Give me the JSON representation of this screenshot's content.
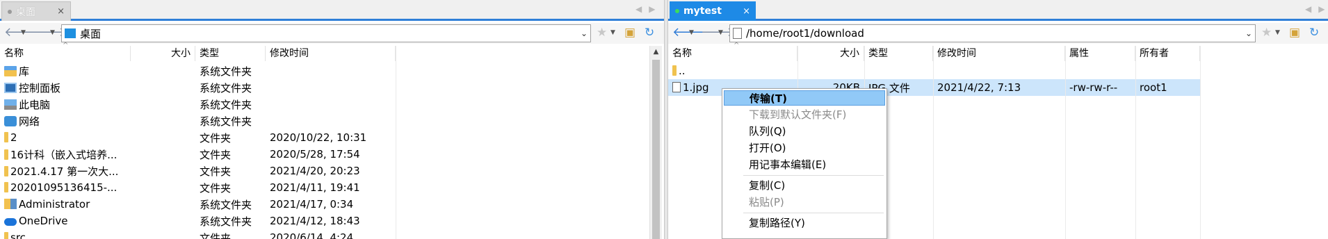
{
  "left": {
    "tab_label": "桌面",
    "tab_close": "×",
    "address": "桌面",
    "columns": [
      "名称",
      "大小",
      "类型",
      "修改时间"
    ],
    "rows": [
      {
        "name": "库",
        "size": "",
        "type": "系统文件夹",
        "modified": "",
        "icon": "library-icon"
      },
      {
        "name": "控制面板",
        "size": "",
        "type": "系统文件夹",
        "modified": "",
        "icon": "control-panel-icon"
      },
      {
        "name": "此电脑",
        "size": "",
        "type": "系统文件夹",
        "modified": "",
        "icon": "computer-icon"
      },
      {
        "name": "网络",
        "size": "",
        "type": "系统文件夹",
        "modified": "",
        "icon": "network-icon"
      },
      {
        "name": "2",
        "size": "",
        "type": "文件夹",
        "modified": "2020/10/22, 10:31",
        "icon": "folder-icon"
      },
      {
        "name": "16计科（嵌入式培养...",
        "size": "",
        "type": "文件夹",
        "modified": "2020/5/28, 17:54",
        "icon": "folder-icon"
      },
      {
        "name": "2021.4.17 第一次大...",
        "size": "",
        "type": "文件夹",
        "modified": "2021/4/20, 20:23",
        "icon": "folder-icon"
      },
      {
        "name": "20201095136415-...",
        "size": "",
        "type": "文件夹",
        "modified": "2021/4/11, 19:41",
        "icon": "folder-icon"
      },
      {
        "name": "Administrator",
        "size": "",
        "type": "系统文件夹",
        "modified": "2021/4/17, 0:34",
        "icon": "user-folder-icon"
      },
      {
        "name": "OneDrive",
        "size": "",
        "type": "系统文件夹",
        "modified": "2021/4/12, 18:43",
        "icon": "onedrive-icon"
      },
      {
        "name": "src",
        "size": "",
        "type": "文件夹",
        "modified": "2020/6/14, 4:24",
        "icon": "folder-icon"
      }
    ]
  },
  "right": {
    "tab_label": "mytest",
    "tab_close": "×",
    "address": "/home/root1/download",
    "columns": [
      "名称",
      "大小",
      "类型",
      "修改时间",
      "属性",
      "所有者"
    ],
    "rows": [
      {
        "name": "..",
        "size": "",
        "type": "",
        "modified": "",
        "attrs": "",
        "owner": "",
        "icon": "parent-folder-icon"
      },
      {
        "name": "1.jpg",
        "size": "20KB",
        "type": "JPG 文件",
        "modified": "2021/4/22, 7:13",
        "attrs": "-rw-rw-r--",
        "owner": "root1",
        "icon": "file-icon"
      }
    ]
  },
  "context_menu": {
    "items": [
      {
        "label": "传输(T)",
        "state": "highlighted"
      },
      {
        "label": "下载到默认文件夹(F)",
        "state": "disabled"
      },
      {
        "label": "队列(Q)",
        "state": "normal"
      },
      {
        "label": "打开(O)",
        "state": "normal"
      },
      {
        "label": "用记事本编辑(E)",
        "state": "normal"
      },
      {
        "label": "复制(C)",
        "state": "normal"
      },
      {
        "label": "粘贴(P)",
        "state": "disabled"
      },
      {
        "label": "复制路径(Y)",
        "state": "normal"
      }
    ]
  },
  "colors": {
    "accent": "#1e8ae6",
    "selection": "#cce5fb",
    "menu_highlight": "#91c9f7",
    "folder": "#f2c14e"
  }
}
